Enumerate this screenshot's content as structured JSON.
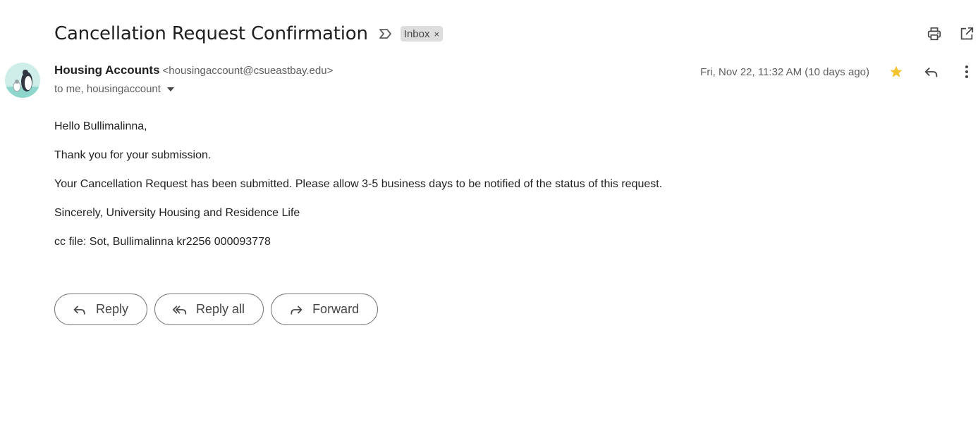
{
  "subject": {
    "title": "Cancellation Request Confirmation",
    "label": "Inbox",
    "label_close": "×"
  },
  "icons": {
    "importance": "importance-marker-icon",
    "print": "print-icon",
    "open_new_window": "open-in-new-window-icon",
    "star": "star-icon",
    "reply": "reply-icon",
    "more": "more-vert-icon",
    "caret": "caret-down-icon",
    "reply_all": "reply-all-icon",
    "forward": "forward-icon"
  },
  "colors": {
    "star": "#f4c430",
    "chip": "#dddddd",
    "muted_text": "#5e5e5e"
  },
  "message": {
    "sender_name": "Housing Accounts",
    "sender_email": "<housingaccount@csueastbay.edu>",
    "recipients": "to me, housingaccount",
    "date": "Fri, Nov 22, 11:32 AM (10 days ago)"
  },
  "body": {
    "greeting": "Hello Bullimalinna,",
    "thanks": "Thank you for your submission.",
    "main": "Your Cancellation Request has been submitted. Please allow 3-5 business days to be notified of the status of this request.",
    "signoff": "Sincerely, University Housing and Residence Life",
    "cc": "cc file: Sot, Bullimalinna kr2256 000093778"
  },
  "buttons": {
    "reply": "Reply",
    "reply_all": "Reply all",
    "forward": "Forward"
  }
}
